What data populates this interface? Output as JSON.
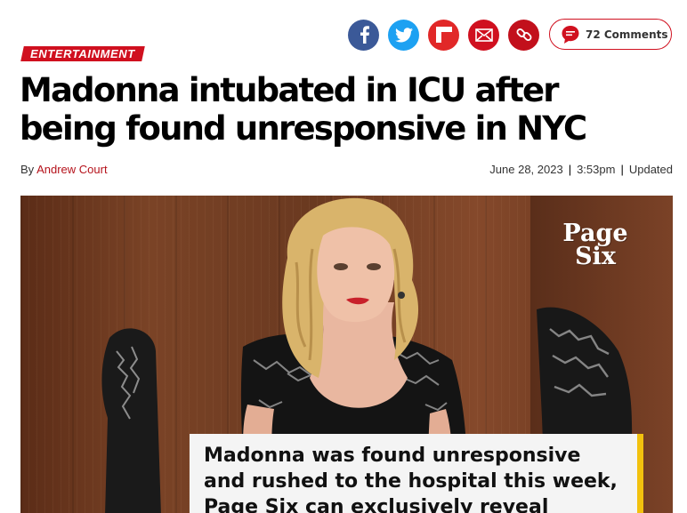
{
  "share": {
    "facebook_icon": "facebook-icon",
    "twitter_icon": "twitter-icon",
    "flipboard_icon": "flipboard-icon",
    "email_icon": "email-icon",
    "link_icon": "link-icon",
    "comments_label": "72 Comments"
  },
  "article": {
    "category": "ENTERTAINMENT",
    "headline": "Madonna intubated in ICU after being found unresponsive in NYC",
    "byline_prefix": "By",
    "author": "Andrew Court",
    "date": "June 28, 2023",
    "time": "3:53pm",
    "updated_label": "Updated"
  },
  "video": {
    "logo_line1": "Page",
    "logo_line2": "Six",
    "caption": "Madonna was found unresponsive and rushed to the hospital this week, Page Six can exclusively reveal"
  },
  "colors": {
    "brand_red": "#d0101f",
    "author_link": "#b5121b",
    "caption_accent": "#f2c10e"
  }
}
